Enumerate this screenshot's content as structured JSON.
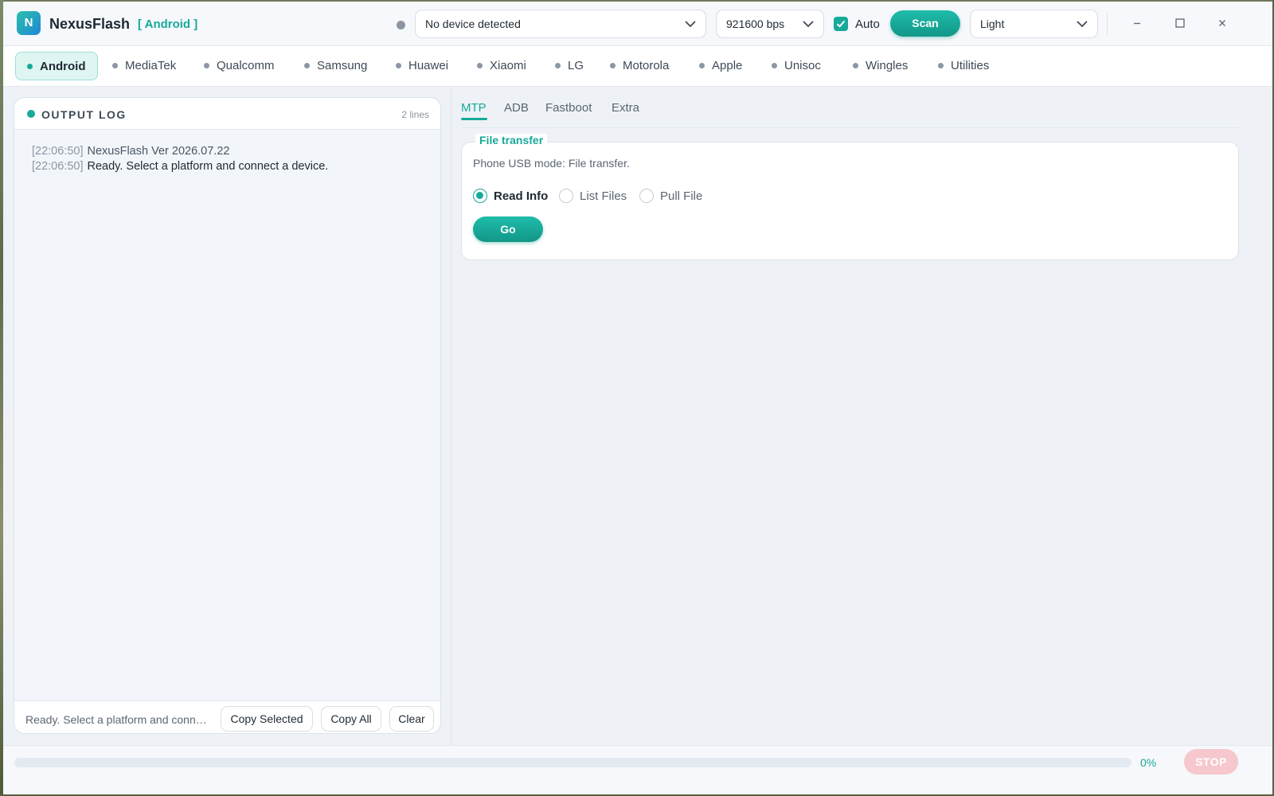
{
  "app": {
    "logo_letter": "N",
    "title": "NexusFlash",
    "platform_tag": "[ Android ]"
  },
  "toolbar": {
    "device": "No device detected",
    "baud": "921600 bps",
    "auto_label": "Auto",
    "auto_checked": true,
    "scan_label": "Scan",
    "theme": "Light",
    "minimize_glyph": "–",
    "close_glyph": "×"
  },
  "platforms": {
    "active": "Android",
    "items": [
      "Android",
      "MediaTek",
      "Qualcomm",
      "Samsung",
      "Huawei",
      "Xiaomi",
      "LG",
      "Motorola",
      "Apple",
      "Unisoc",
      "Wingles",
      "Utilities"
    ]
  },
  "log": {
    "title": "OUTPUT LOG",
    "count": "2 lines",
    "lines": [
      {
        "ts": "[22:06:50]",
        "msg": "NexusFlash Ver 2026.07.22"
      },
      {
        "ts": "[22:06:50]",
        "msg": "Ready. Select a platform and connect a device."
      }
    ],
    "status": "Ready. Select a platform and connect a device.",
    "copy_selected": "Copy Selected",
    "copy_all": "Copy All",
    "clear": "Clear"
  },
  "tabs": {
    "active": "MTP",
    "items": [
      "MTP",
      "ADB",
      "Fastboot",
      "Extra"
    ]
  },
  "mtp": {
    "group_title": "File transfer",
    "description": "Phone USB mode: File transfer.",
    "options": [
      "Read Info",
      "List Files",
      "Pull File"
    ],
    "selected": "Read Info",
    "go_label": "Go"
  },
  "progress": {
    "value": 0,
    "label": "0%",
    "stop_label": "STOP"
  },
  "colors": {
    "accent": "#17a99a",
    "stop_disabled": "#f6c7cc"
  }
}
